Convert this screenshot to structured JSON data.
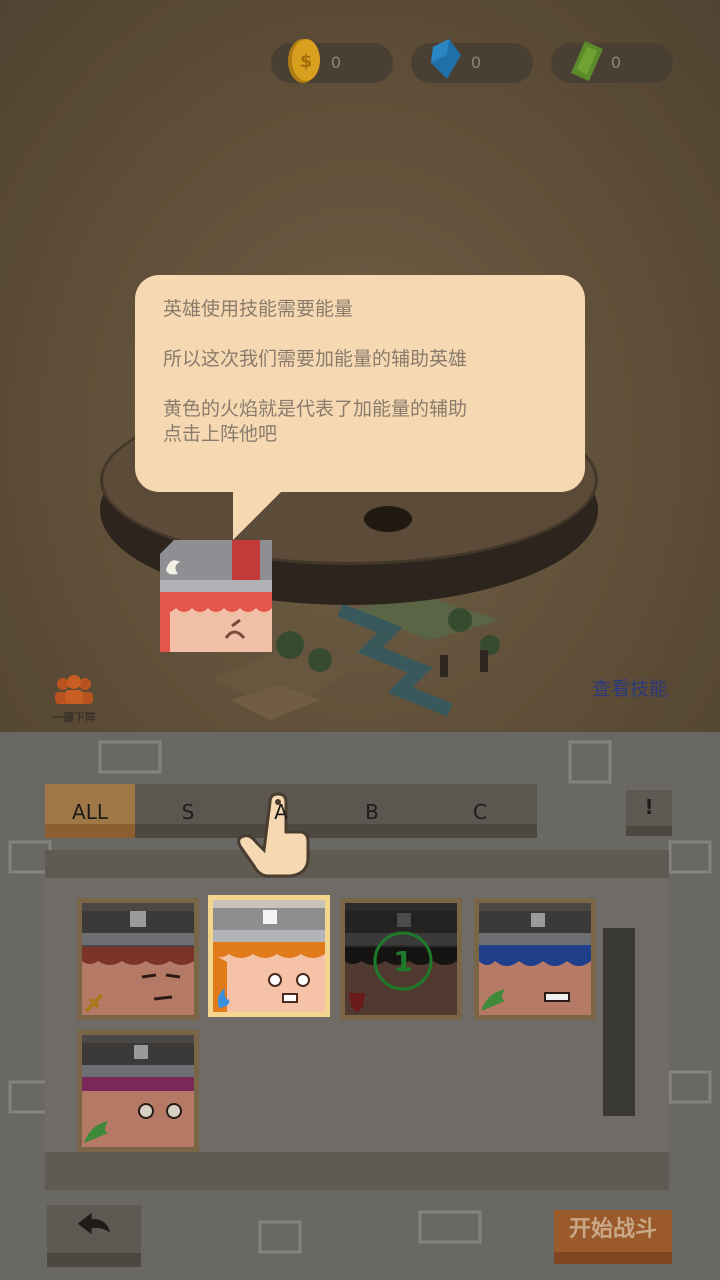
{
  "resources": [
    {
      "name": "gold-coin",
      "value": "0",
      "color": "#d9a020"
    },
    {
      "name": "blue-diamond",
      "value": "0",
      "color": "#1f6fa8"
    },
    {
      "name": "green-cash",
      "value": "0",
      "color": "#5c8a2a"
    }
  ],
  "tutorial": {
    "line1": "英雄使用技能需要能量",
    "line2": "所以这次我们需要加能量的辅助英雄",
    "line3": "黄色的火焰就是代表了加能量的辅助",
    "line4": "点击上阵他吧"
  },
  "one_key_label": "一键下阵",
  "view_skill_label": "查看技能",
  "tabs": [
    "ALL",
    "S",
    "A",
    "B",
    "C"
  ],
  "active_tab": "ALL",
  "warn_label": "!",
  "heroes": [
    {
      "name": "hero-sword",
      "badge": "sword-icon",
      "hair": "#a0522d",
      "selected": false,
      "locked": false
    },
    {
      "name": "hero-energy",
      "badge": "flame-icon",
      "hair": "#e07a1a",
      "selected": true,
      "locked": false
    },
    {
      "name": "hero-shield",
      "badge": "shield-icon",
      "hair": "#2a2a2a",
      "selected": false,
      "locked": true,
      "lock_number": "1"
    },
    {
      "name": "hero-wing-blue",
      "badge": "wing-icon",
      "hair": "#1f3f8a",
      "selected": false,
      "locked": false
    },
    {
      "name": "hero-wing-purple",
      "badge": "wing-icon",
      "hair": "#7a2a5a",
      "selected": false,
      "locked": false
    }
  ],
  "start_label": "开始战斗",
  "colors": {
    "bubble": "#f6d9b3",
    "accent_tab": "#a07848",
    "start_btn": "#9a5a2c"
  }
}
